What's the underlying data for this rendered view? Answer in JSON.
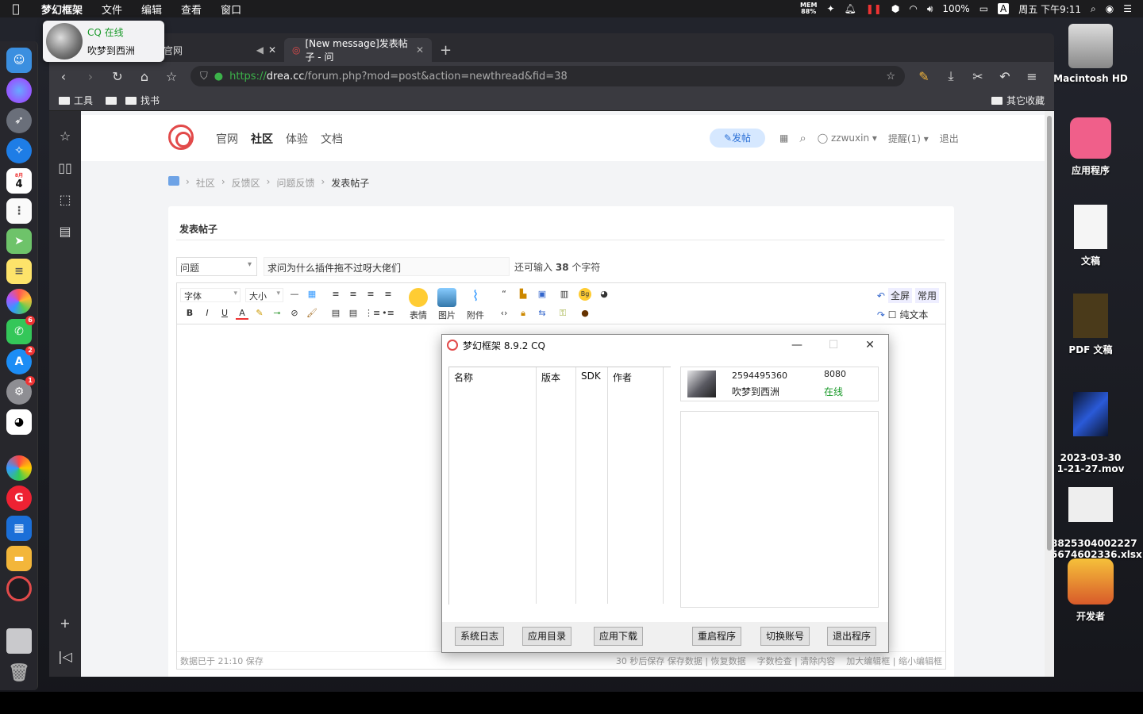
{
  "menubar": {
    "app": "梦幻框架",
    "items": [
      "文件",
      "编辑",
      "查看",
      "窗口"
    ],
    "mem_label": "MEM",
    "mem_value": "88%",
    "battery": "100%",
    "input_method": "A",
    "datetime": "周五 下午9:11"
  },
  "notification": {
    "title": "CQ 在线",
    "body": "吹梦到西洲"
  },
  "dock": {
    "calendar_day": "4",
    "calendar_month": "8月",
    "badges": [
      "6",
      "2",
      "1"
    ]
  },
  "browser": {
    "tabs": [
      {
        "label": "区 - 官网"
      },
      {
        "label": "[New message]发表帖子 - 问"
      }
    ],
    "url_scheme": "https://",
    "url_host": "drea.cc",
    "url_path": "/forum.php?mod=post&action=newthread&fid=38",
    "bookmarks": [
      "工具",
      "找书"
    ],
    "other_bookmarks": "其它收藏"
  },
  "site": {
    "nav": [
      "官网",
      "社区",
      "体验",
      "文档"
    ],
    "post_button": "✎发帖",
    "username": "zzwuxin",
    "reminder": "提醒(1)",
    "logout": "退出",
    "breadcrumbs": [
      "社区",
      "反馈区",
      "问题反馈",
      "发表帖子"
    ],
    "card_title": "发表帖子",
    "category": "问题",
    "subject": "求问为什么插件拖不过呀大佬们",
    "remain_prefix": "还可输入",
    "remain_count": "38",
    "remain_suffix": "个字符",
    "toolbar": {
      "font": "字体",
      "size": "大小",
      "emoji": "表情",
      "image": "图片",
      "attach": "附件",
      "fullscreen": "全屏",
      "common": "常用",
      "plaintext": "纯文本"
    },
    "status_left": "数据已于 21:10 保存",
    "status_right": [
      "30 秒后保存 保存数据 | 恢复数据",
      "字数检查 | 清除内容",
      "加大编辑框 | 缩小编辑框"
    ]
  },
  "dialog": {
    "title": "梦幻框架 8.9.2 CQ",
    "columns": [
      "名称",
      "版本",
      "SDK",
      "作者"
    ],
    "qq": "2594495360",
    "port": "8080",
    "nickname": "吹梦到西洲",
    "status": "在线",
    "buttons": [
      "系统日志",
      "应用目录",
      "应用下载",
      "重启程序",
      "切换账号",
      "退出程序"
    ]
  },
  "desktop_icons": [
    {
      "label": "Macintosh HD"
    },
    {
      "label": "应用程序"
    },
    {
      "label": "文稿"
    },
    {
      "label": "PDF 文稿"
    },
    {
      "label": "2023-03-30\n1-21-27.mov"
    },
    {
      "label": "8825304002227\n5674602336.xlsx"
    },
    {
      "label": "开发者"
    }
  ]
}
